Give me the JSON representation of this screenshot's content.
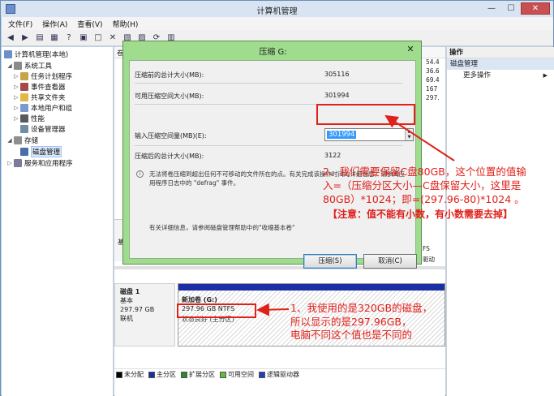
{
  "window": {
    "title": "计算机管理",
    "minimize": "—",
    "maximize": "☐",
    "close": "✕"
  },
  "menu": [
    "文件(F)",
    "操作(A)",
    "查看(V)",
    "帮助(H)"
  ],
  "toolbar_icons": [
    "back-icon",
    "forward-icon",
    "up-folder-icon",
    "show-tree-icon",
    "help-icon",
    "properties-icon",
    "new-icon",
    "delete-icon",
    "export-icon",
    "open-icon",
    "refresh-icon",
    "settings-icon"
  ],
  "tree": {
    "root": "计算机管理(本地)",
    "items": [
      {
        "label": "系统工具",
        "level": 1,
        "expanded": true
      },
      {
        "label": "任务计划程序",
        "level": 2
      },
      {
        "label": "事件查看器",
        "level": 2
      },
      {
        "label": "共享文件夹",
        "level": 2
      },
      {
        "label": "本地用户和组",
        "level": 2
      },
      {
        "label": "性能",
        "level": 2
      },
      {
        "label": "设备管理器",
        "level": 2
      },
      {
        "label": "存储",
        "level": 1,
        "expanded": true
      },
      {
        "label": "磁盘管理",
        "level": 2,
        "selected": true
      },
      {
        "label": "服务和应用程序",
        "level": 1
      }
    ]
  },
  "middle": {
    "header_fragment": "卷",
    "right_values": [
      "54.4",
      "36.6",
      "69.4",
      "167",
      "297."
    ],
    "disk0": {
      "label_fragment": "基",
      "fs_fragment": "FS",
      "status_fragment": "驱动"
    },
    "disk1": {
      "name": "磁盘 1",
      "type": "基本",
      "size": "297.97 GB",
      "state": "联机",
      "volume_name": "新加卷  (G:)",
      "volume_size": "297.96 GB NTFS",
      "volume_status": "状态良好 (主分区)"
    },
    "legend": [
      {
        "label": "未分配",
        "color": "#000000"
      },
      {
        "label": "主分区",
        "color": "#1b2fa5"
      },
      {
        "label": "扩展分区",
        "color": "#2b8a2b"
      },
      {
        "label": "可用空间",
        "color": "#5cbf3c"
      },
      {
        "label": "逻辑驱动器",
        "color": "#2040c0"
      }
    ]
  },
  "actions": {
    "header": "操作",
    "section": "磁盘管理",
    "items": [
      "更多操作"
    ]
  },
  "dialog": {
    "title": "压缩 G:",
    "close": "✕",
    "rows": [
      {
        "label": "压缩前的总计大小(MB):",
        "value": "305116"
      },
      {
        "label": "可用压缩空间大小(MB):",
        "value": "301994"
      },
      {
        "label": "输入压缩空间量(MB)(E):",
        "value": "301994"
      },
      {
        "label": "压缩后的总计大小(MB):",
        "value": "3122"
      }
    ],
    "note": "无法将卷压缩到超出任何不可移动的文件所在的点。有关完成该操作时间的详细信息，请参阅应用程序日志中的 \"defrag\" 事件。",
    "help": "有关详细信息，请参阅磁盘管理帮助中的\"收缩基本卷\"",
    "ok": "压缩(S)",
    "cancel": "取消(C)"
  },
  "annotations": {
    "note2_l1": "2、我们需要保留C盘80GB，这个位置的值输",
    "note2_l2": "入=（压缩分区大小—C盘保留大小，这里是",
    "note2_l3": "80GB）*1024；即=(297.96-80)*1024 。",
    "note2_l4": "【注意：值不能有小数，有小数需要去掉】",
    "note1_l1": "1、我使用的是320GB的磁盘，",
    "note1_l2": "所以显示的是297.96GB，",
    "note1_l3": "电脑不同这个值也是不同的",
    "color": "#e0201a"
  }
}
